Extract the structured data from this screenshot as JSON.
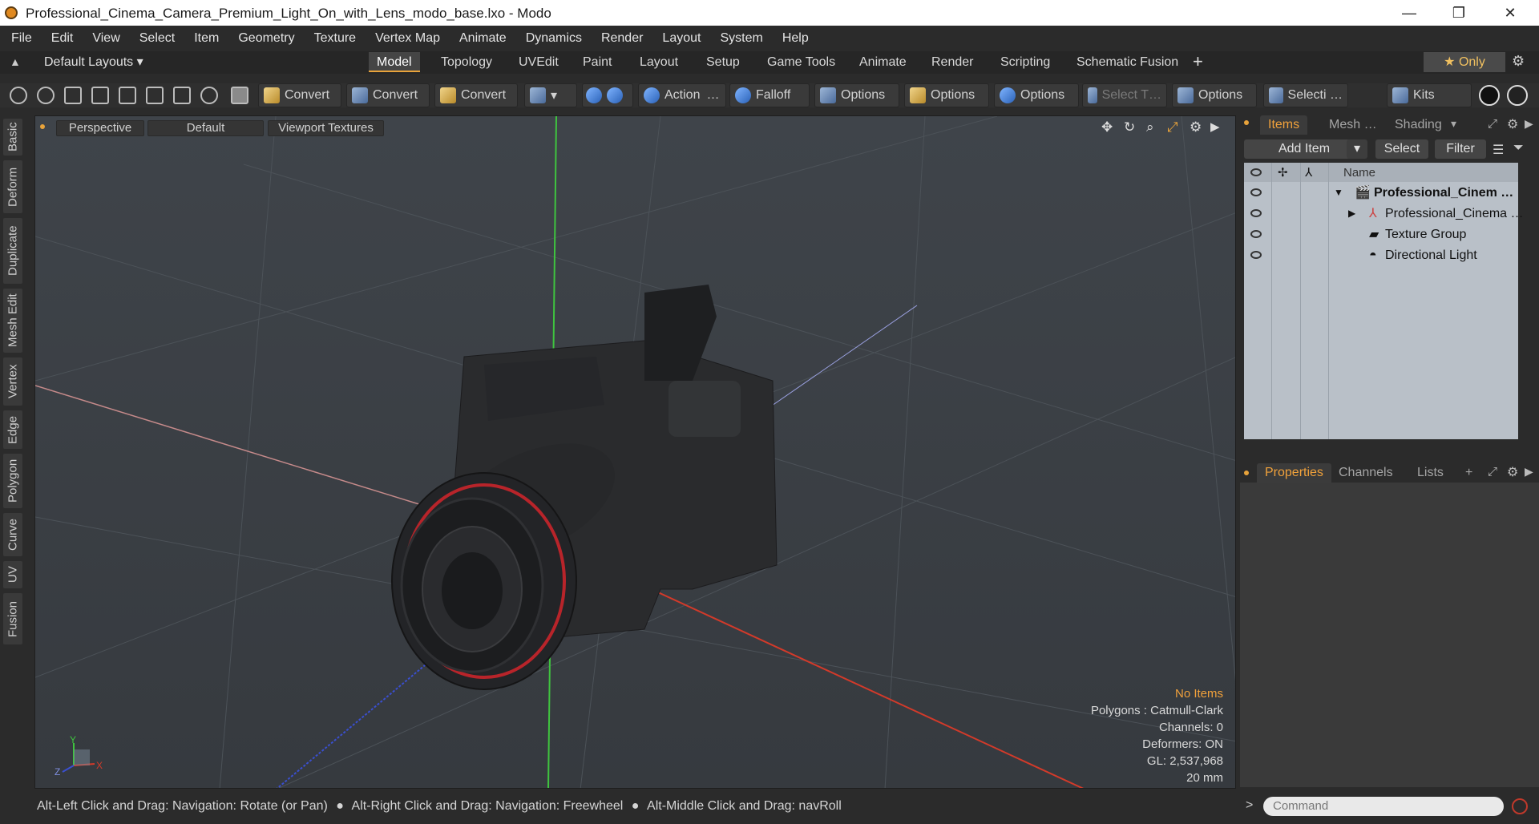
{
  "window": {
    "title": "Professional_Cinema_Camera_Premium_Light_On_with_Lens_modo_base.lxo - Modo",
    "minimize": "—",
    "maximize": "❐",
    "close": "✕"
  },
  "menu": [
    "File",
    "Edit",
    "View",
    "Select",
    "Item",
    "Geometry",
    "Texture",
    "Vertex Map",
    "Animate",
    "Dynamics",
    "Render",
    "Layout",
    "System",
    "Help"
  ],
  "layout_selector": "Default Layouts ▾",
  "tabs": [
    "Model",
    "Topology",
    "UVEdit",
    "Paint",
    "Layout",
    "Setup",
    "Game Tools",
    "Animate",
    "Render",
    "Scripting",
    "Schematic Fusion"
  ],
  "active_tab": "Model",
  "tab_add": "+",
  "only_label": "★ Only",
  "toolbar": {
    "convert1": "Convert",
    "convert2": "Convert",
    "convert3": "Convert",
    "action": "Action",
    "action_more": "…",
    "falloff": "Falloff",
    "options1": "Options",
    "options2": "Options",
    "options3": "Options",
    "select_t": "Select T…",
    "options4": "Options",
    "selecti": "Selecti …",
    "kits": "Kits"
  },
  "left_tabs": [
    "Basic",
    "Deform",
    "Duplicate",
    "Mesh Edit",
    "Vertex",
    "Edge",
    "Polygon",
    "Curve",
    "UV",
    "Fusion"
  ],
  "viewport": {
    "perspective": "Perspective",
    "default": "Default",
    "textures": "Viewport Textures",
    "hud": {
      "no_items": "No Items",
      "polygons": "Polygons : Catmull-Clark",
      "channels": "Channels: 0",
      "deformers": "Deformers: ON",
      "gl": "GL: 2,537,968",
      "scale": "20 mm"
    },
    "axis_labels": {
      "x": "X",
      "y": "Y",
      "z": "Z"
    }
  },
  "items_panel": {
    "tabs": [
      "Items",
      "Mesh …",
      "Shading"
    ],
    "add_item": "Add Item",
    "select": "Select",
    "filter": "Filter",
    "name_header": "Name",
    "rows": [
      {
        "label": "Professional_Cinem …"
      },
      {
        "label": "Professional_Cinema …"
      },
      {
        "label": "Texture Group"
      },
      {
        "label": "Directional Light"
      }
    ]
  },
  "props_panel": {
    "tabs": [
      "Properties",
      "Channels",
      "Lists"
    ],
    "add": "+"
  },
  "statusbar": {
    "hint1": "Alt-Left Click and Drag: Navigation: Rotate (or Pan)",
    "hint2": "Alt-Right Click and Drag: Navigation: Freewheel",
    "hint3": "Alt-Middle Click and Drag: navRoll"
  },
  "command_placeholder": "Command",
  "colors": {
    "accent": "#e8a33b",
    "list_bg": "#b9c0c8"
  }
}
